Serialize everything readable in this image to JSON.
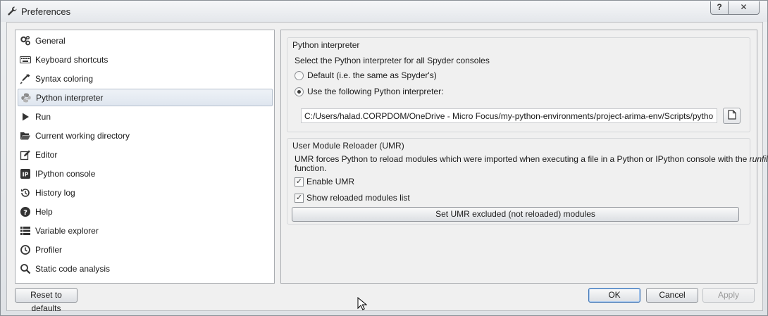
{
  "window": {
    "title": "Preferences",
    "help_glyph": "?",
    "close_glyph": "✕"
  },
  "sidebar": {
    "items": [
      {
        "label": "General",
        "icon": "gears-icon"
      },
      {
        "label": "Keyboard shortcuts",
        "icon": "keyboard-icon"
      },
      {
        "label": "Syntax coloring",
        "icon": "eyedropper-icon"
      },
      {
        "label": "Python interpreter",
        "icon": "python-icon",
        "selected": true
      },
      {
        "label": "Run",
        "icon": "play-icon"
      },
      {
        "label": "Current working directory",
        "icon": "folder-open-icon"
      },
      {
        "label": "Editor",
        "icon": "edit-icon"
      },
      {
        "label": "IPython console",
        "icon": "ipython-icon"
      },
      {
        "label": "History log",
        "icon": "history-icon"
      },
      {
        "label": "Help",
        "icon": "question-circle-icon"
      },
      {
        "label": "Variable explorer",
        "icon": "table-list-icon"
      },
      {
        "label": "Profiler",
        "icon": "clock-icon"
      },
      {
        "label": "Static code analysis",
        "icon": "search-code-icon"
      }
    ]
  },
  "interpreter": {
    "group_title": "Python interpreter",
    "description": "Select the Python interpreter for all Spyder consoles",
    "option_default": "Default (i.e. the same as Spyder's)",
    "option_custom": "Use the following Python interpreter:",
    "selected_option": "custom",
    "path_value": "C:/Users/halad.CORPDOM/OneDrive - Micro Focus/my-python-environments/project-arima-env/Scripts/python.exe"
  },
  "umr": {
    "group_title": "User Module Reloader (UMR)",
    "description_before": "UMR forces Python to reload modules which were imported when executing a file in a Python or IPython console with the ",
    "description_italic": "runfile",
    "description_after": "function.",
    "enable_label": "Enable UMR",
    "enable_checked": true,
    "show_label": "Show reloaded modules list",
    "show_checked": true,
    "excluded_button": "Set UMR excluded (not reloaded) modules"
  },
  "footer": {
    "reset_button": "Reset to defaults",
    "ok_button": "OK",
    "cancel_button": "Cancel",
    "apply_button": "Apply"
  }
}
